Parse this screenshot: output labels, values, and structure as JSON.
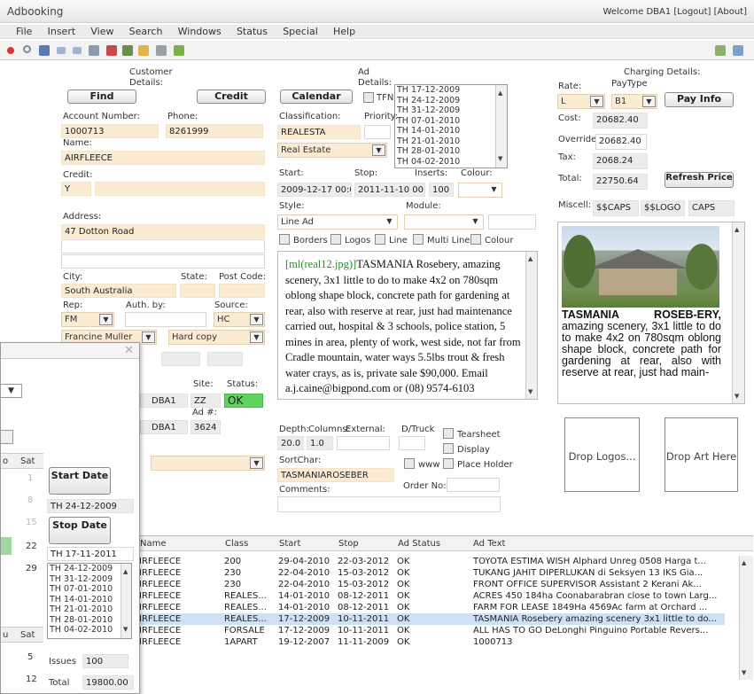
{
  "app": {
    "title": "Adbooking",
    "welcome": "Welcome DBA1 [Logout] [About]"
  },
  "menu": [
    "File",
    "Insert",
    "View",
    "Search",
    "Windows",
    "Status",
    "Special",
    "Help"
  ],
  "colors": {
    "field": "#fbebd2",
    "selected_row": "#cde0f4",
    "status_ok": "#5ed35e"
  },
  "customer": {
    "section": "Customer Details:",
    "find": "Find",
    "credit_btn": "Credit",
    "account_label": "Account Number:",
    "account": "1000713",
    "phone_label": "Phone:",
    "phone": "8261999",
    "name_label": "Name:",
    "name": "AIRFLEECE",
    "credit_label": "Credit:",
    "credit": "Y",
    "address_label": "Address:",
    "address": "47 Dotton Road",
    "city_label": "City:",
    "city": "South Australia",
    "state_label": "State:",
    "post_label": "Post Code:",
    "rep_label": "Rep:",
    "rep": "FM",
    "auth_label": "Auth. by:",
    "source_label": "Source:",
    "source": "HC",
    "rep_name": "Francine Muller",
    "copy": "Hard copy",
    "site_label": "Site:",
    "site": "ZZ",
    "status_label": "Status:",
    "status": "OK",
    "user1": "DBA1",
    "user2": "DBA1",
    "adno_label": "Ad #:",
    "adno": "3624"
  },
  "ad": {
    "section": "Ad Details:",
    "calendar": "Calendar",
    "tfn": "TFN",
    "dates": [
      "TH 17-12-2009",
      "TH 24-12-2009",
      "TH 31-12-2009",
      "TH 07-01-2010",
      "TH 14-01-2010",
      "TH 21-01-2010",
      "TH 28-01-2010",
      "TH 04-02-2010"
    ],
    "classification_label": "Classification:",
    "classification": "REALESTA",
    "priority_label": "Priority:",
    "class_select": "Real Estate",
    "start_label": "Start:",
    "start": "2009-12-17 00:0",
    "stop_label": "Stop:",
    "stop": "2011-11-10 00:0",
    "inserts_label": "Inserts:",
    "inserts": "100",
    "colour_label": "Colour:",
    "style_label": "Style:",
    "style": "Line Ad",
    "module_label": "Module:",
    "opt_borders": "Borders",
    "opt_logos": "Logos",
    "opt_line": "Line",
    "opt_multiline": "Multi Line",
    "opt_colour": "Colour",
    "text_tag": "[ml(real12.jpg)]",
    "text_body": "TASMANIA Rosebery, amazing scenery, 3x1 little to do to make 4x2 on 780sqm oblong shape block, concrete path for gardening at rear, also with reserve at rear, just had maintenance carried out, hospital & 3 schools, police station, 5 mines in area, plenty of work, west side, not far from Cradle mountain, water ways 5.5lbs trout & fresh water crays, as is, private sale $90,000. Email a.j.caine@bigpond.com or (08) 9574-6103",
    "depth_label": "Depth:",
    "depth": "20.0",
    "columns_label": "Columns:",
    "columns": "1.0",
    "external_label": "External:",
    "dtruck_label": "D/Truck",
    "tearsheet": "Tearsheet",
    "display": "Display",
    "www": "www",
    "placeholder": "Place Holder",
    "sortchar_label": "SortChar:",
    "sortchar": "TASMANIAROSEBER",
    "order_label": "Order No:",
    "comments_label": "Comments:"
  },
  "charging": {
    "section": "Charging Details:",
    "rate_label": "Rate:",
    "paytype_label": "PayType",
    "rate": "L",
    "paytype": "B1",
    "payinfo": "Pay Info",
    "cost_label": "Cost:",
    "cost": "20682.40",
    "override_label": "Override:",
    "override": "20682.40",
    "tax_label": "Tax:",
    "tax": "2068.24",
    "total_label": "Total:",
    "total": "22750.64",
    "refresh": "Refresh Price",
    "miscell_label": "Miscell:",
    "m1": "$$CAPS",
    "m2": "$$LOGO",
    "m3": "CAPS"
  },
  "preview": {
    "headline": "TASMANIA ROSEB-ERY,",
    "body": "amazing scenery, 3x1 little to do to make 4x2 on 780sqm oblong shape block, concrete path for gardening at rear, also with reserve at rear, just had main-"
  },
  "drop": {
    "logos": "Drop Logos...",
    "art": "Drop Art Here"
  },
  "calendar_win": {
    "sat": "Sat",
    "days_top": [
      "1",
      "8",
      "15",
      "22",
      "29"
    ],
    "days_bottom": [
      "5",
      "12"
    ],
    "start_btn": "Start Date",
    "start_val": "TH 24-12-2009",
    "stop_btn": "Stop Date",
    "stop_val": "TH 17-11-2011",
    "dates": [
      "TH 24-12-2009",
      "TH 31-12-2009",
      "TH 07-01-2010",
      "TH 14-01-2010",
      "TH 21-01-2010",
      "TH 28-01-2010",
      "TH 04-02-2010"
    ],
    "issues_label": "Issues",
    "issues": "100",
    "total_label": "Total",
    "total": "19800.00"
  },
  "table": {
    "headers": [
      "Name",
      "Class",
      "Start",
      "Stop",
      "Ad Status",
      "Ad Text"
    ],
    "rows": [
      [
        "IRFLEECE",
        "200",
        "29-04-2010",
        "22-03-2012",
        "OK",
        "TOYOTA ESTIMA WISH Alphard Unreg 0508 Harga t..."
      ],
      [
        "IRFLEECE",
        "230",
        "22-04-2010",
        "15-03-2012",
        "OK",
        "TUKANG JAHIT DIPERLUKAN di Seksyen 13 IKS Gia..."
      ],
      [
        "IRFLEECE",
        "230",
        "22-04-2010",
        "15-03-2012",
        "OK",
        "FRONT OFFICE SUPERVISOR  Assistant 2 Kerani Ak..."
      ],
      [
        "IRFLEECE",
        "REALES...",
        "14-01-2010",
        "08-12-2011",
        "OK",
        "ACRES 450 184ha Coonabarabran close to town Larg..."
      ],
      [
        "IRFLEECE",
        "REALES...",
        "14-01-2010",
        "08-12-2011",
        "OK",
        "FARM FOR LEASE 1849Ha 4569Ac farm at Orchard ..."
      ],
      [
        "IRFLEECE",
        "REALES...",
        "17-12-2009",
        "10-11-2011",
        "OK",
        "TASMANIA Rosebery amazing scenery 3x1 little to do..."
      ],
      [
        "IRFLEECE",
        "FORSALE",
        "17-12-2009",
        "10-11-2011",
        "OK",
        "ALL HAS TO GO DeLonghi Pinguino Portable Revers..."
      ],
      [
        "IRFLEECE",
        "1APART",
        "19-12-2007",
        "11-11-2009",
        "OK",
        "1000713"
      ]
    ]
  }
}
